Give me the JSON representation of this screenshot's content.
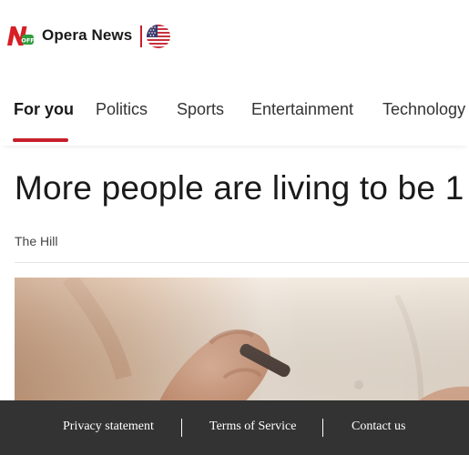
{
  "header": {
    "logo_icon": "opera-news-logo-icon",
    "brand_name": "Opera News",
    "region_flag_icon": "us-flag-icon",
    "accent_color": "#c71f2c"
  },
  "nav": {
    "tabs": [
      {
        "label": "For you",
        "active": true
      },
      {
        "label": "Politics",
        "active": false
      },
      {
        "label": "Sports",
        "active": false
      },
      {
        "label": "Entertainment",
        "active": false
      },
      {
        "label": "Technology",
        "active": false
      }
    ]
  },
  "article": {
    "headline": "More people are living to be 1",
    "source": "The Hill"
  },
  "footer": {
    "background_color": "#333333",
    "links": [
      {
        "label": "Privacy statement"
      },
      {
        "label": "Terms of Service"
      },
      {
        "label": "Contact us"
      }
    ]
  }
}
